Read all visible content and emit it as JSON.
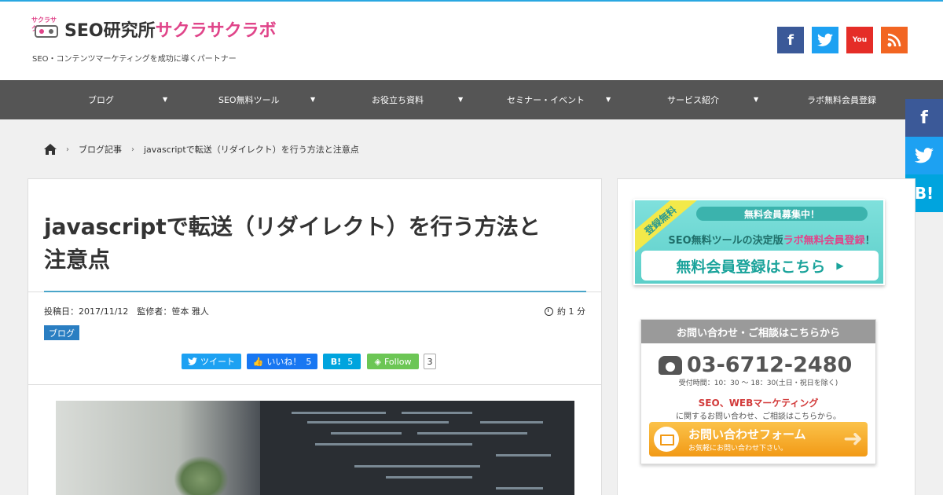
{
  "header": {
    "logo_seo": "SEO研究所",
    "logo_pink": "サクラサクラボ",
    "logo_mark_text": "サクラサク",
    "tagline": "SEO・コンテンツマーケティングを成功に導くパートナー",
    "social": [
      {
        "icon": "facebook-icon",
        "glyph": "f",
        "color": "#3b5998"
      },
      {
        "icon": "twitter-icon",
        "glyph": "🐦",
        "color": "#1da1f2"
      },
      {
        "icon": "youtube-icon",
        "glyph": "You",
        "color": "#e52d27"
      },
      {
        "icon": "rss-icon",
        "glyph": "◉",
        "color": "#f26522"
      }
    ]
  },
  "nav": {
    "items": [
      "ブログ",
      "SEO無料ツール",
      "お役立ち資料",
      "セミナー・イベント",
      "サービス紹介",
      "ラボ無料会員登録"
    ],
    "arrow": "▼"
  },
  "side_share": {
    "facebook": "f",
    "twitter": "🐦",
    "hatena": "B!",
    "colors": {
      "facebook": "#3b5998",
      "twitter": "#1da1f2",
      "hatena": "#00a4de"
    }
  },
  "breadcrumb": {
    "home_icon": "home-icon",
    "items": [
      "ブログ記事",
      "javascriptで転送（リダイレクト）を行う方法と注意点"
    ],
    "separator": "›"
  },
  "article": {
    "title_line1": "javascriptで転送（リダイレクト）を行う方法と",
    "title_line2": "注意点",
    "meta": "投稿日：2017/11/12　監修者：笹本 雅人",
    "read_time": "約 1 分",
    "category": "ブログ",
    "share": {
      "tweet": "ツイート",
      "like": "いいね！",
      "like_count": "5",
      "hatena": "B!",
      "hatena_count": "5",
      "follow": "Follow",
      "follow_count": "3"
    }
  },
  "sidebar": {
    "banner1": {
      "ribbon": "登録無料",
      "pill": "無料会員募集中！",
      "line_a": "SEO無料ツールの決定版",
      "line_pink": "ラボ無料会員登録",
      "line_b": "！",
      "button": "無料会員登録はこちら",
      "arrow": "▶"
    },
    "banner2": {
      "head": "お問い合わせ・ご相談はこちらから",
      "phone": "03-6712-2480",
      "hours": "受付時間：10：30 〜 18：30(土日・祝日を除く)",
      "seo": "SEO、WEBマーケティング",
      "sub": "に関するお問い合わせ、ご相談はこちらから。",
      "button_main": "お問い合わせフォーム",
      "button_sub": "お気軽にお問い合わせ下さい。",
      "button_arrow": "➜"
    }
  }
}
